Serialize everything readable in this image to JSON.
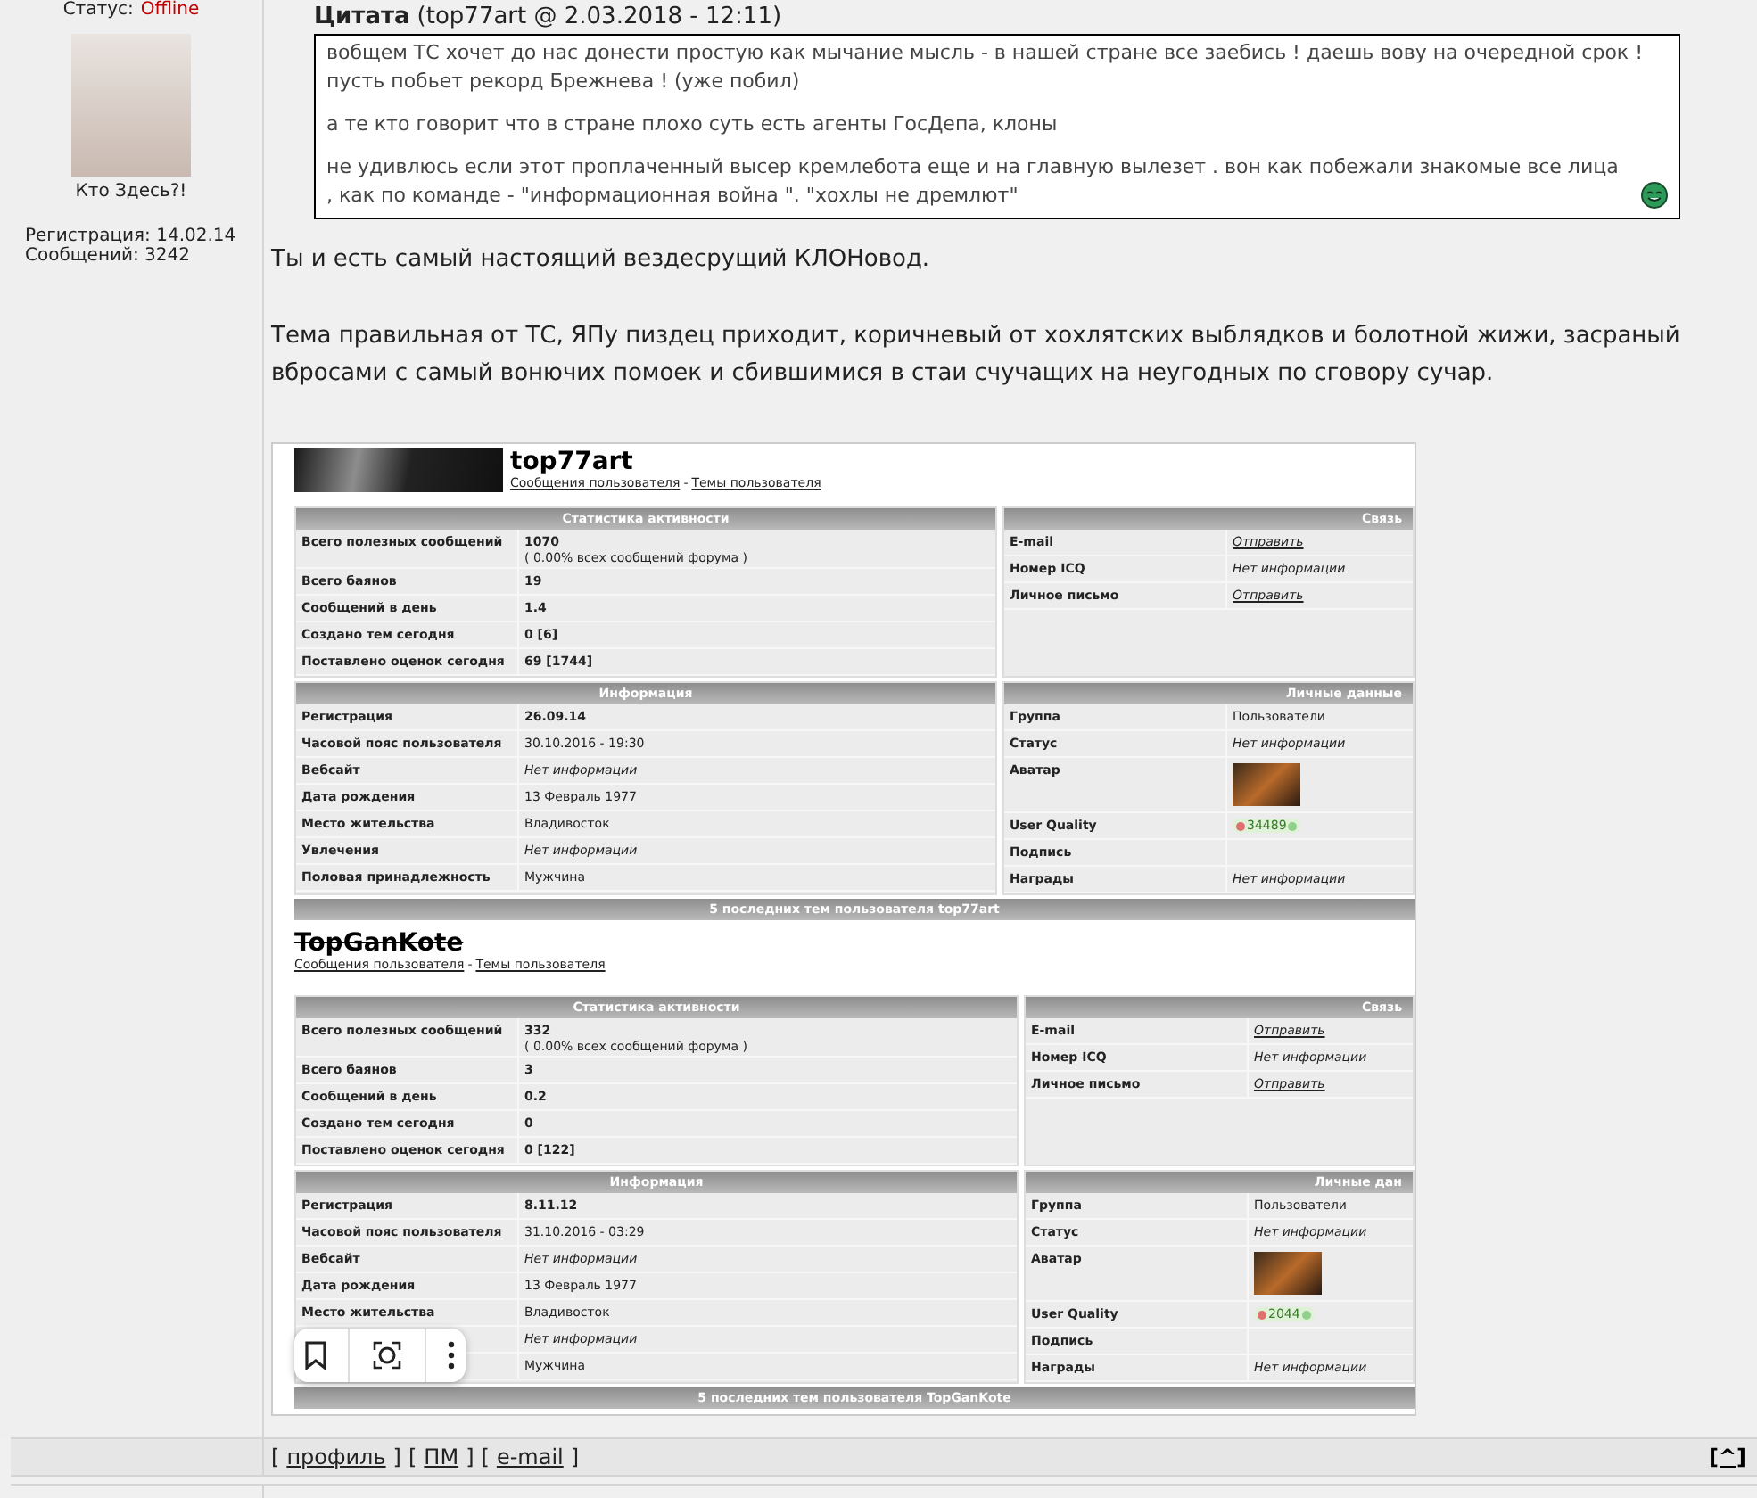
{
  "author": {
    "status_label": "Статус:",
    "status": "Offline",
    "online": false,
    "caption": "Кто Здесь?!",
    "registration": "Регистрация: 14.02.14",
    "posts": "Сообщений: 3242"
  },
  "quote": {
    "title": "Цитата",
    "source": "(top77art @ 2.03.2018 - 12:11)",
    "paragraphs": [
      "вобщем ТС хочет до нас донести простую как мычание мысль - в нашей стране все заебись ! даешь вову на очередной срок ! пусть побьет рекорд Брежнева ! (уже побил)",
      "а те кто говорит что в стране плохо суть есть агенты ГосДепа, клоны",
      "не удивлюсь если этот проплаченный высер кремлебота еще и на главную вылезет . вон как побежали знакомые все лица , как по команде - \"информационная война \". \"хохлы не дремлют\""
    ]
  },
  "paragraphs": [
    "Ты и есть самый настоящий вездесрущий КЛОНовод.",
    "Тема правильная от ТС, ЯПу пиздец приходит, коричневый от хохлятских выблядков и болотной жижи, засраный вбросами с самый вонючих помоек и сбившимися в стаи счучащих на неугодных по сговору сучар."
  ],
  "profiles": [
    {
      "name": "top77art",
      "struck": false,
      "banner": true,
      "links": [
        "Сообщения пользователя",
        "Темы пользователя"
      ],
      "separator": "-",
      "panels": [
        {
          "title": "Статистика активности",
          "rows": [
            {
              "label": "Всего полезных сообщений",
              "value": "1070",
              "note": "( 0.00% всех сообщений форума )",
              "kind": "bold"
            },
            {
              "label": "Всего баянов",
              "value": "19",
              "kind": "bold"
            },
            {
              "label": "Сообщений в день",
              "value": "1.4",
              "kind": "bold"
            },
            {
              "label": "Создано тем сегодня",
              "value": "0 [6]",
              "kind": "bold"
            },
            {
              "label": "Поставлено оценок сегодня",
              "value": "69 [1744]",
              "kind": "bold"
            }
          ]
        },
        {
          "title": "Связь",
          "rows": [
            {
              "label": "E-mail",
              "value": "Отправить",
              "kind": "link"
            },
            {
              "label": "Номер ICQ",
              "value": "Нет информации",
              "kind": "italic"
            },
            {
              "label": "Личное письмо",
              "value": "Отправить",
              "kind": "link"
            }
          ]
        },
        {
          "title": "Информация",
          "rows": [
            {
              "label": "Регистрация",
              "value": "26.09.14",
              "kind": "bold"
            },
            {
              "label": "Часовой пояс пользователя",
              "value": "30.10.2016 - 19:30",
              "kind": "plain"
            },
            {
              "label": "Вебсайт",
              "value": "Нет информации",
              "kind": "italic"
            },
            {
              "label": "Дата рождения",
              "value": "13 Февраль 1977",
              "kind": "plain"
            },
            {
              "label": "Место жительства",
              "value": "Владивосток",
              "kind": "plain"
            },
            {
              "label": "Увлечения",
              "value": "Нет информации",
              "kind": "italic"
            },
            {
              "label": "Половая принадлежность",
              "value": "Мужчина",
              "kind": "plain"
            }
          ]
        },
        {
          "title": "Личные данные",
          "rows": [
            {
              "label": "Группа",
              "value": "Пользователи",
              "kind": "plain"
            },
            {
              "label": "Статус",
              "value": "Нет информации",
              "kind": "italic"
            },
            {
              "label": "Аватар",
              "kind": "avatar"
            },
            {
              "label": "User Quality",
              "value": "34489",
              "kind": "quality"
            },
            {
              "label": "Подпись",
              "kind": "plain"
            },
            {
              "label": "Награды",
              "value": "Нет информации",
              "kind": "italic"
            }
          ]
        }
      ],
      "footer": "5 последних тем пользователя top77art"
    },
    {
      "name": "TopGanKote",
      "struck": true,
      "banner": false,
      "links": [
        "Сообщения пользователя",
        "Темы пользователя"
      ],
      "separator": "-",
      "panels": [
        {
          "title": "Статистика активности",
          "rows": [
            {
              "label": "Всего полезных сообщений",
              "value": "332",
              "note": "( 0.00% всех сообщений форума )",
              "kind": "bold"
            },
            {
              "label": "Всего баянов",
              "value": "3",
              "kind": "bold"
            },
            {
              "label": "Сообщений в день",
              "value": "0.2",
              "kind": "bold"
            },
            {
              "label": "Создано тем сегодня",
              "value": "0",
              "kind": "bold"
            },
            {
              "label": "Поставлено оценок сегодня",
              "value": "0 [122]",
              "kind": "bold"
            }
          ]
        },
        {
          "title": "Связь",
          "rows": [
            {
              "label": "E-mail",
              "value": "Отправить",
              "kind": "link"
            },
            {
              "label": "Номер ICQ",
              "value": "Нет информации",
              "kind": "italic"
            },
            {
              "label": "Личное письмо",
              "value": "Отправить",
              "kind": "link"
            }
          ]
        },
        {
          "title": "Информация",
          "rows": [
            {
              "label": "Регистрация",
              "value": "8.11.12",
              "kind": "bold"
            },
            {
              "label": "Часовой пояс пользователя",
              "value": "31.10.2016 - 03:29",
              "kind": "plain"
            },
            {
              "label": "Вебсайт",
              "value": "Нет информации",
              "kind": "italic"
            },
            {
              "label": "Дата рождения",
              "value": "13 Февраль 1977",
              "kind": "plain"
            },
            {
              "label": "Место жительства",
              "value": "Владивосток",
              "kind": "plain"
            },
            {
              "value": "Нет информации",
              "kind": "italic"
            },
            {
              "value": "Мужчина",
              "kind": "plain"
            }
          ]
        },
        {
          "title": "Личные дан",
          "rows": [
            {
              "label": "Группа",
              "value": "Пользователи",
              "kind": "plain"
            },
            {
              "label": "Статус",
              "value": "Нет информации",
              "kind": "italic"
            },
            {
              "label": "Аватар",
              "kind": "avatar"
            },
            {
              "label": "User Quality",
              "value": "2044",
              "kind": "quality"
            },
            {
              "label": "Подпись",
              "kind": "plain"
            },
            {
              "label": "Награды",
              "value": "Нет информации",
              "kind": "italic"
            }
          ]
        }
      ],
      "footer": "5 последних тем пользователя TopGanKote"
    }
  ],
  "post_links": [
    {
      "open": "[",
      "label": "профиль",
      "close": "]"
    },
    {
      "open": "[",
      "label": "ПМ",
      "close": "]"
    },
    {
      "open": "[",
      "label": "e-mail",
      "close": "]"
    }
  ],
  "top_link": "[^]"
}
